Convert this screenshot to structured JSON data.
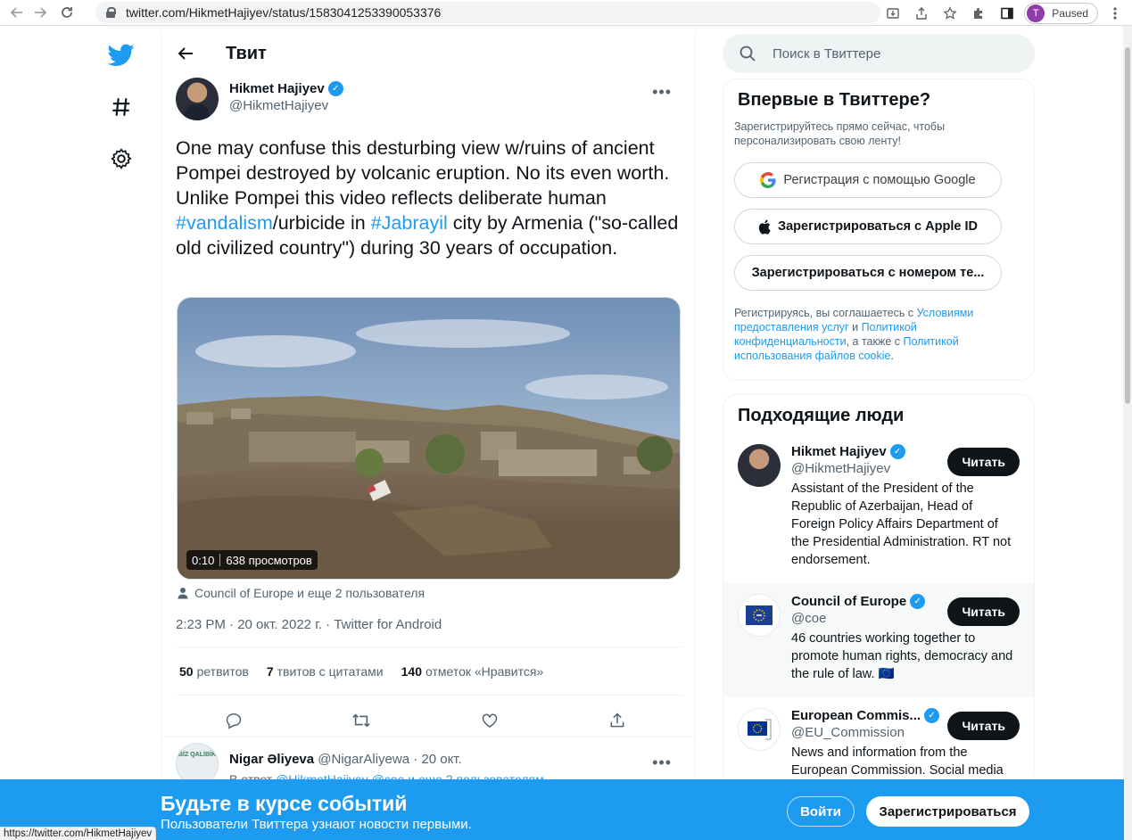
{
  "browser": {
    "url": "twitter.com/HikmetHajiyev/status/1583041253390053376",
    "profile_initial": "T",
    "profile_status": "Paused",
    "status_url": "https://twitter.com/HikmetHajiyev"
  },
  "header": {
    "title": "Твит"
  },
  "tweet": {
    "author_name": "Hikmet Hajiyev",
    "author_handle": "@HikmetHajiyev",
    "text_parts": {
      "p1": "One may confuse this desturbing view w/ruins of ancient Pompei destroyed by volcanic eruption. No its even worth. Unlike Pompei this video reflects deliberate human ",
      "tag1": "#vandalism",
      "p2": "/urbicide in ",
      "tag2": "#Jabrayil",
      "p3": " city by Armenia (\"so-called old civilized country\") during 30 years of occupation."
    },
    "video_time": "0:10",
    "video_views": "638 просмотров",
    "tagged": "Council of Europe и еще 2 пользователя",
    "timestamp": "2:23 PM · 20 окт. 2022 г. · Twitter for Android",
    "stats": {
      "retweets_count": "50",
      "retweets_label": "ретвитов",
      "quotes_count": "7",
      "quotes_label": "твитов с цитатами",
      "likes_count": "140",
      "likes_label": "отметок «Нравится»"
    }
  },
  "reply": {
    "avatar_text": "BİZ QALİBİK",
    "name": "Nigar Əliyeva",
    "handle_time": "@NigarAliyewa · 20 окт.",
    "sub_prefix": "В ответ ",
    "sub_links": "@HikmetHajiyev @coe и еще 2 пользователям"
  },
  "search": {
    "placeholder": "Поиск в Твиттере"
  },
  "new_card": {
    "title": "Впервые в Твиттере?",
    "subtitle": "Зарегистрируйтесь прямо сейчас, чтобы персонализировать свою ленту!",
    "google_btn": "Регистрация с помощью Google",
    "apple_btn": "Зарегистрироваться с Apple ID",
    "phone_btn": "Зарегистрироваться с номером те...",
    "legal": {
      "t1": "Регистрируясь, вы соглашаетесь с ",
      "l1": "Условиями предоставления услуг",
      "t2": " и ",
      "l2": "Политикой конфиденциальности",
      "t3": ", а также с ",
      "l3": "Политикой использования файлов cookie",
      "t4": "."
    }
  },
  "people": {
    "title": "Подходящие люди",
    "follow_label": "Читать",
    "items": [
      {
        "name": "Hikmet Hajiyev",
        "handle": "@HikmetHajiyev",
        "bio": "Assistant of the President of the Republic of Azerbaijan, Head of Foreign Policy Affairs Department of the Presidential Administration. RT not endorsement."
      },
      {
        "name": "Council of Europe",
        "handle": "@coe",
        "bio": "46 countries working together to promote human rights, democracy and the rule of law. 🇪🇺"
      },
      {
        "name": "European Commis...",
        "handle": "@EU_Commission",
        "bio": "News and information from the European Commission. Social media"
      }
    ]
  },
  "banner": {
    "title": "Будьте в курсе событий",
    "subtitle": "Пользователи Твиттера узнают новости первыми.",
    "login": "Войти",
    "register": "Зарегистрироваться"
  },
  "colors": {
    "accent": "#1d9bf0",
    "text": "#0f1419",
    "muted": "#536471"
  }
}
